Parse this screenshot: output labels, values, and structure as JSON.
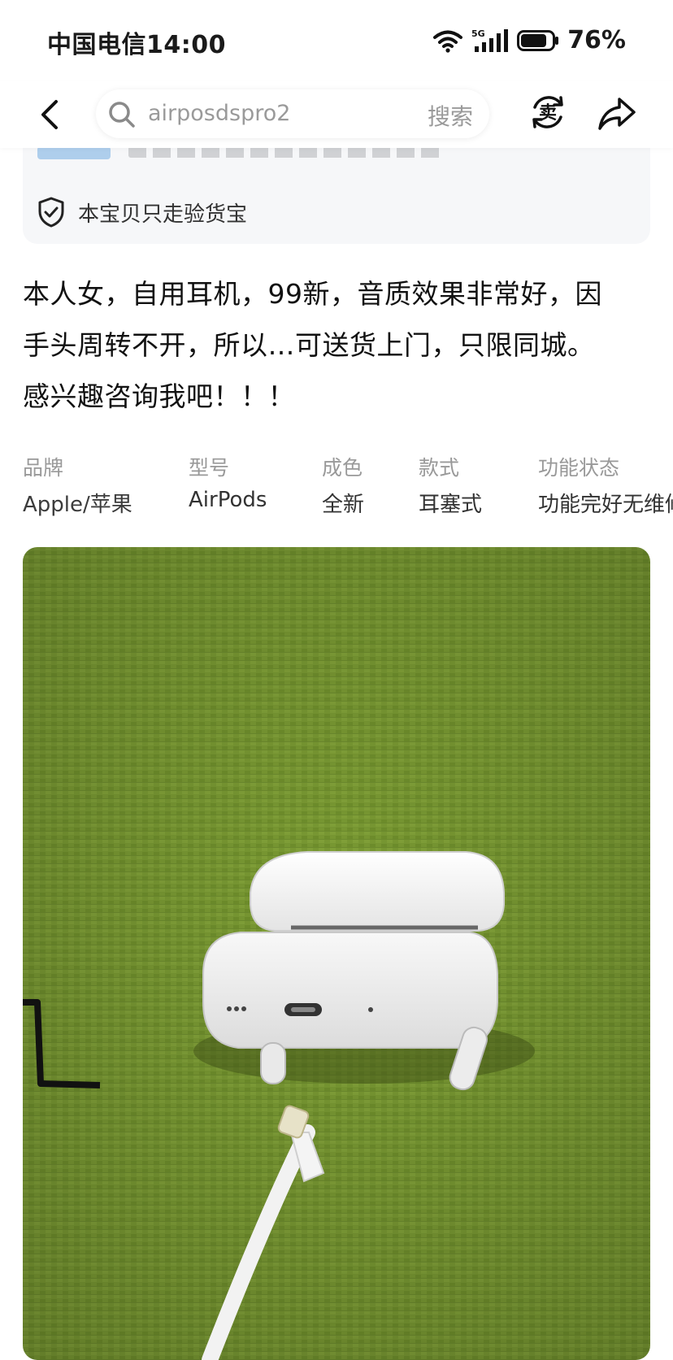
{
  "status_bar": {
    "carrier_time": "中国电信14:00",
    "network_small": "6",
    "network_label": "5G",
    "battery": "76%"
  },
  "search": {
    "query": "airposdspro2",
    "button": "搜索"
  },
  "header_actions": {
    "sell_label": "卖"
  },
  "verification": {
    "text": "本宝贝只走验货宝"
  },
  "description": {
    "lines": [
      "本人女，自用耳机，99新，音质效果非常好，因",
      "手头周转不开，所以…可送货上门，只限同城。",
      "感兴趣咨询我吧！！！"
    ]
  },
  "attributes": [
    {
      "label": "品牌",
      "value": "Apple/苹果"
    },
    {
      "label": "型号",
      "value": "AirPods"
    },
    {
      "label": "成色",
      "value": "全新"
    },
    {
      "label": "款式",
      "value": "耳塞式"
    },
    {
      "label": "功能状态",
      "value": "功能完好无维修"
    }
  ],
  "colors": {
    "accent_blue": "#7fb2e3",
    "brand_value": "#3c3c3c",
    "photo_background": "#7a9a33"
  }
}
